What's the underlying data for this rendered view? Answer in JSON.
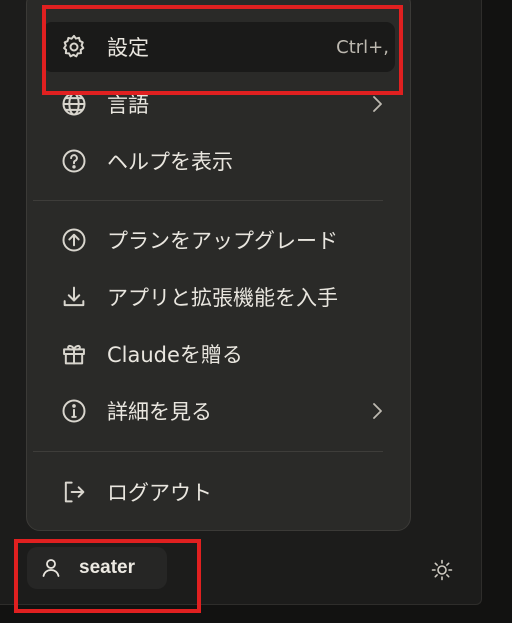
{
  "menu": {
    "items": [
      {
        "label": "設定",
        "shortcut": "Ctrl+,",
        "icon": "gear-icon"
      },
      {
        "label": "言語",
        "icon": "globe-icon",
        "has_submenu": true
      },
      {
        "label": "ヘルプを表示",
        "icon": "help-circle-icon"
      },
      {
        "label": "プランをアップグレード",
        "icon": "upgrade-arrow-icon"
      },
      {
        "label": "アプリと拡張機能を入手",
        "icon": "download-icon"
      },
      {
        "label": "Claudeを贈る",
        "icon": "gift-icon"
      },
      {
        "label": "詳細を見る",
        "icon": "info-icon",
        "has_submenu": true
      },
      {
        "label": "ログアウト",
        "icon": "logout-icon"
      }
    ]
  },
  "user": {
    "name": "seater"
  },
  "colors": {
    "highlight_box": "#e02020",
    "menu_bg": "#2a2a28",
    "panel_bg": "#1c1c1b"
  }
}
